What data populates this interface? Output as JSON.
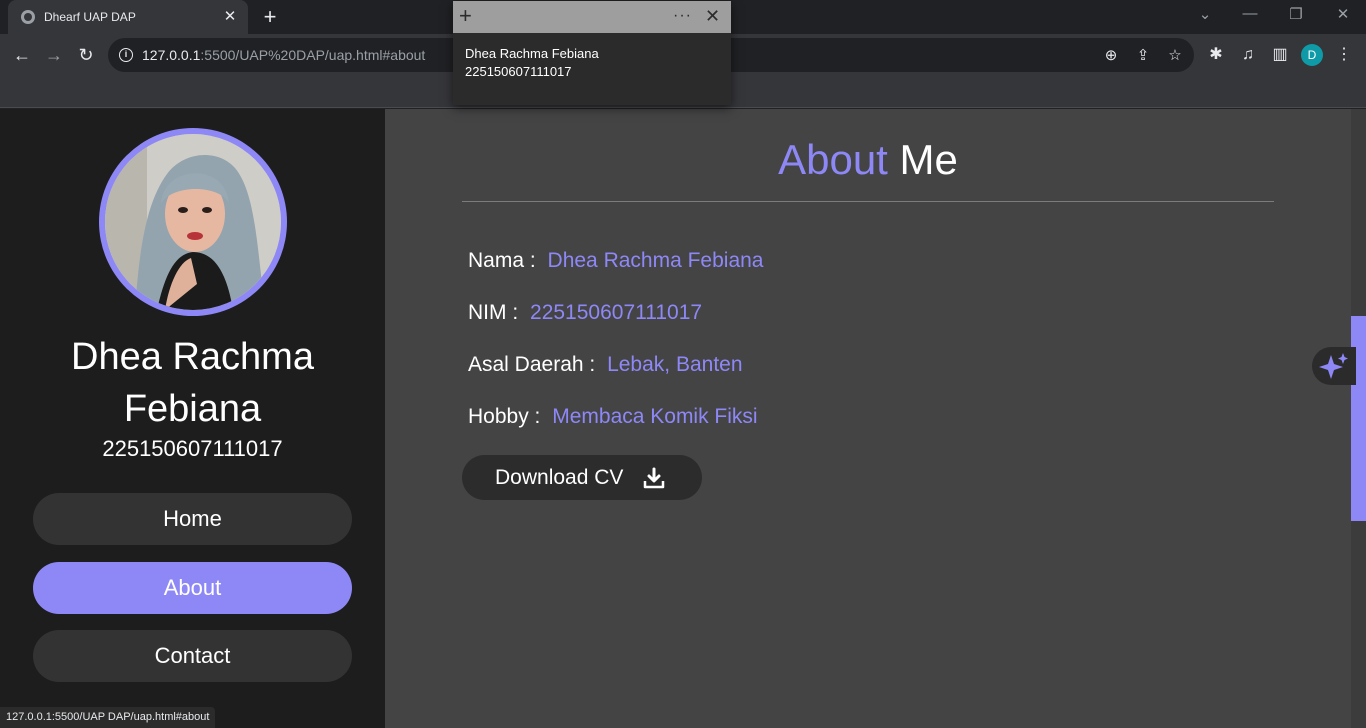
{
  "browser": {
    "tab_title": "Dhearf UAP DAP",
    "url_host": "127.0.0.1",
    "url_path": ":5500/UAP%20DAP/uap.html#about",
    "profile_initial": "D"
  },
  "popup": {
    "line1": "Dhea Rachma Febiana",
    "line2": "225150607111017"
  },
  "sidebar": {
    "name": "Dhea Rachma Febiana",
    "nim": "225150607111017",
    "nav": [
      {
        "label": "Home"
      },
      {
        "label": "About"
      },
      {
        "label": "Contact"
      }
    ]
  },
  "about": {
    "heading_accent": "About",
    "heading_rest": "Me",
    "rows": [
      {
        "label": "Nama :",
        "value": "Dhea Rachma Febiana"
      },
      {
        "label": "NIM :",
        "value": "225150607111017"
      },
      {
        "label": "Asal Daerah :",
        "value": "Lebak, Banten"
      },
      {
        "label": "Hobby :",
        "value": "Membaca Komik Fiksi"
      }
    ],
    "download_label": "Download CV"
  },
  "status_bar": "127.0.0.1:5500/UAP DAP/uap.html#about",
  "colors": {
    "accent": "#8e88f7",
    "sidebar_bg": "#1d1d1e",
    "main_bg": "#444445"
  }
}
